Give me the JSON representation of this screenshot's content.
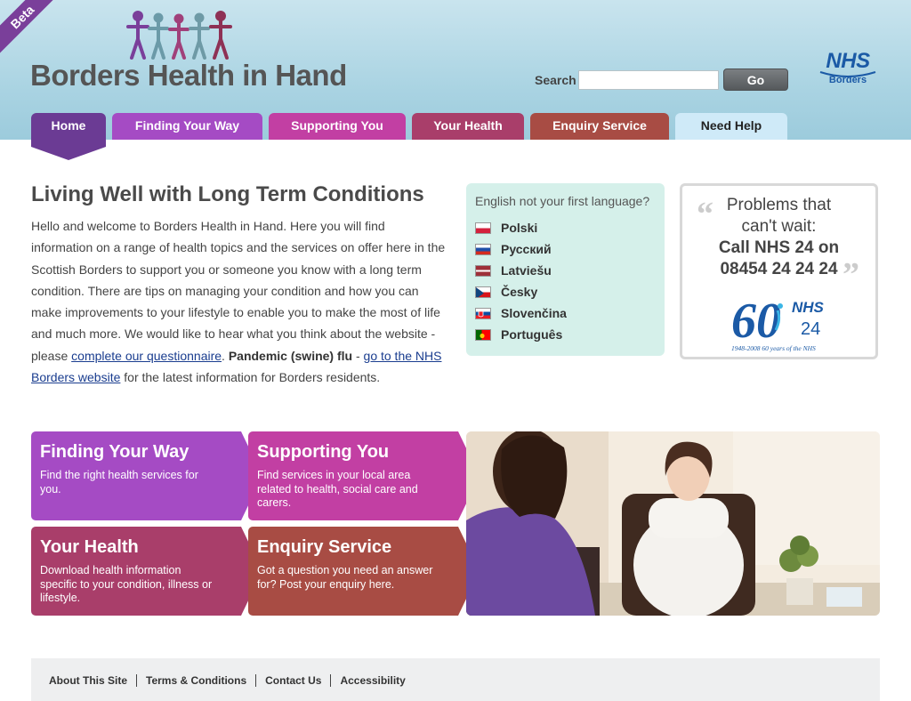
{
  "header": {
    "beta_label": "Beta",
    "site_title": "Borders Health in Hand",
    "search_label": "Search",
    "search_value": "",
    "go_label": "Go",
    "nhs_logo_text": "NHS",
    "nhs_logo_sub": "Borders"
  },
  "nav": {
    "tabs": [
      {
        "label": "Home",
        "color": "#6b3b94"
      },
      {
        "label": "Finding Your Way",
        "color": "#a54bc4"
      },
      {
        "label": "Supporting You",
        "color": "#c23fa3"
      },
      {
        "label": "Your Health",
        "color": "#a93e6a"
      },
      {
        "label": "Enquiry Service",
        "color": "#a84c44"
      },
      {
        "label": "Need Help",
        "color": "#cfeaf8"
      }
    ]
  },
  "intro": {
    "title": "Living Well with Long Term Conditions",
    "text1": "Hello and welcome to Borders Health in Hand. Here you will find information on a range of health topics and the services on offer here in the Scottish Borders to support you or someone you know with a long term condition. There are tips on managing your condition and how you can make improvements to your lifestyle to enable you to make the most of life and much more. We would like to hear what you think about the website - please ",
    "link_questionnaire": "complete our questionnaire",
    "text2": ". ",
    "bold_flu": "Pandemic (swine) flu",
    "text3": " - ",
    "link_nhs": "go to the NHS Borders website",
    "text4": " for the latest information for Borders residents."
  },
  "languages": {
    "title": "English not your first language?",
    "items": [
      {
        "label": "Polski",
        "flag": "poland"
      },
      {
        "label": "Русский",
        "flag": "russia"
      },
      {
        "label": "Latviešu",
        "flag": "latvia"
      },
      {
        "label": "Česky",
        "flag": "czech"
      },
      {
        "label": "Slovenčina",
        "flag": "slovakia"
      },
      {
        "label": "Português",
        "flag": "portugal"
      }
    ]
  },
  "nhs24": {
    "line1a": "Problems that",
    "line1b": "can't wait:",
    "line2a": "Call NHS 24 on",
    "line2b": "08454 24 24 24",
    "logo_number": "60",
    "logo_nhs": "NHS",
    "logo_24": "24",
    "logo_caption": "1948-2008 60 years of the NHS"
  },
  "tiles": [
    {
      "title": "Finding Your Way",
      "desc": "Find the right health services for you."
    },
    {
      "title": "Supporting You",
      "desc": "Find services in your local area related to health, social care and carers."
    },
    {
      "title": "Your Health",
      "desc": "Download health information specific to your condition, illness or lifestyle."
    },
    {
      "title": "Enquiry Service",
      "desc": "Got a question you need an answer for? Post your enquiry here."
    }
  ],
  "footer": {
    "links": [
      "About This Site",
      "Terms & Conditions",
      "Contact Us",
      "Accessibility"
    ]
  }
}
